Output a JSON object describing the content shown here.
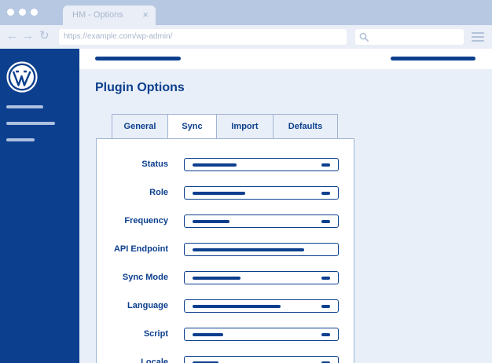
{
  "browser": {
    "tab_title": "HM - Options",
    "tab_close": "×",
    "back_glyph": "←",
    "forward_glyph": "→",
    "reload_glyph": "↻",
    "url": "https://example.com/wp-admin/",
    "search_placeholder": ""
  },
  "page": {
    "title": "Plugin Options"
  },
  "tabs": [
    {
      "label": "General",
      "active": false
    },
    {
      "label": "Sync",
      "active": true
    },
    {
      "label": "Import",
      "active": false
    },
    {
      "label": "Defaults",
      "active": false
    }
  ],
  "fields": [
    {
      "label": "Status",
      "value_fill": 0.32,
      "has_knob": true
    },
    {
      "label": "Role",
      "value_fill": 0.38,
      "has_knob": true
    },
    {
      "label": "Frequency",
      "value_fill": 0.27,
      "has_knob": true
    },
    {
      "label": "API Endpoint",
      "value_fill": 0.81,
      "has_knob": false
    },
    {
      "label": "Sync Mode",
      "value_fill": 0.35,
      "has_knob": true
    },
    {
      "label": "Language",
      "value_fill": 0.64,
      "has_knob": true
    },
    {
      "label": "Script",
      "value_fill": 0.22,
      "has_knob": true
    },
    {
      "label": "Locale",
      "value_fill": 0.19,
      "has_knob": true
    }
  ],
  "colors": {
    "brand": "#0c3f8e",
    "chrome": "#b7c8e2",
    "background": "#e9eff8"
  },
  "icons": {
    "logo": "wordpress-logo",
    "search": "search-icon",
    "menu": "hamburger-menu-icon"
  }
}
